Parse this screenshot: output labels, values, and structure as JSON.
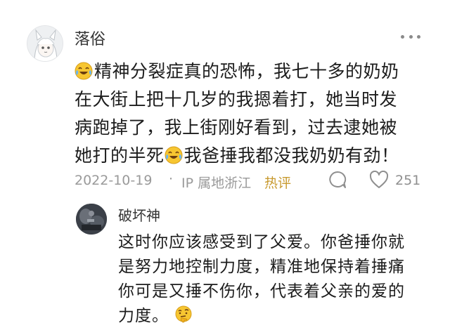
{
  "comment": {
    "username": "落俗",
    "text_line1": "精神分裂症真的恐怖，我七十多的奶奶",
    "text_line2": "在大街上把十几岁的我摁着打，她当时发",
    "text_line3": "病跑掉了，我上街刚好看到，过去逮她被",
    "text_line4a": "她打的半死",
    "text_line4b": "我爸捶我都没我奶奶有劲！",
    "date": "2022-10-19",
    "separator": "·",
    "ip": "IP 属地浙江",
    "hot_label": "热评",
    "like_count": "251",
    "emoji": "laughing-crying-emoji"
  },
  "reply": {
    "username": "破坏神",
    "text_line1": "这时你应该感受到了父爱。你爸捶你就",
    "text_line2": "是努力地控制力度，精准地保持着捶痛",
    "text_line3": "你可是又捶不伤你，代表着父亲的爱的",
    "text_line4": "力度。",
    "emoji": "thinking-face-emoji"
  },
  "icons": {
    "more": "more-dots-icon",
    "reply": "reply-bubble-icon",
    "like": "heart-icon"
  },
  "colors": {
    "meta_gray": "#9a9a9a",
    "hot": "#c89a2f",
    "emoji_yellow": "#f7c631"
  }
}
